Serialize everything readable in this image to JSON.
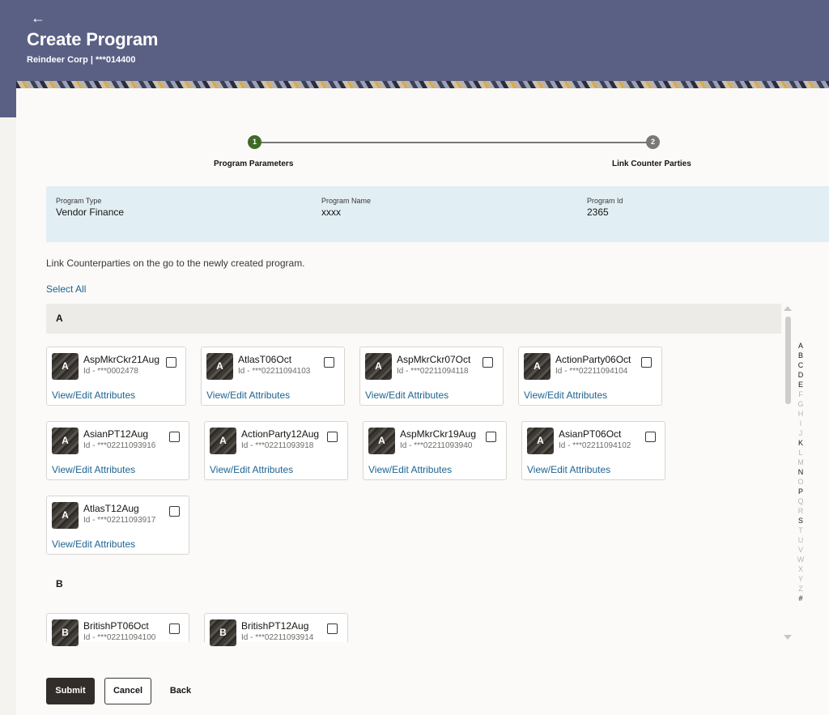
{
  "header": {
    "back_icon": "←",
    "title": "Create Program",
    "subtitle": "Reindeer Corp | ***014400"
  },
  "stepper": {
    "steps": [
      {
        "number": "1",
        "label": "Program Parameters",
        "status": "complete",
        "color": "#3f6a27"
      },
      {
        "number": "2",
        "label": "Link Counter Parties",
        "status": "current",
        "color": "#7a7875"
      }
    ]
  },
  "program": {
    "type_label": "Program Type",
    "type_value": "Vendor Finance",
    "name_label": "Program Name",
    "name_value": "xxxx",
    "id_label": "Program Id",
    "id_value": "2365"
  },
  "intro_text": "Link Counterparties on the go to the newly created program.",
  "select_all": "Select All",
  "link_label": "View/Edit Attributes",
  "groups": [
    {
      "letter": "A",
      "counterparties": [
        {
          "initial": "A",
          "name": "AspMkrCkr21Aug",
          "id": "Id - ***0002478"
        },
        {
          "initial": "A",
          "name": "AtlasT06Oct",
          "id": "Id - ***02211094103"
        },
        {
          "initial": "A",
          "name": "AspMkrCkr07Oct",
          "id": "Id - ***02211094118"
        },
        {
          "initial": "A",
          "name": "ActionParty06Oct",
          "id": "Id - ***02211094104"
        },
        {
          "initial": "A",
          "name": "AsianPT12Aug",
          "id": "Id - ***02211093916"
        },
        {
          "initial": "A",
          "name": "ActionParty12Aug",
          "id": "Id - ***02211093918"
        },
        {
          "initial": "A",
          "name": "AspMkrCkr19Aug",
          "id": "Id - ***02211093940"
        },
        {
          "initial": "A",
          "name": "AsianPT06Oct",
          "id": "Id - ***02211094102"
        },
        {
          "initial": "A",
          "name": "AtlasT12Aug",
          "id": "Id - ***02211093917"
        }
      ]
    },
    {
      "letter": "B",
      "counterparties": [
        {
          "initial": "B",
          "name": "BritishPT06Oct",
          "id": "Id - ***02211094100"
        },
        {
          "initial": "B",
          "name": "BritishPT12Aug",
          "id": "Id - ***02211093914"
        }
      ]
    }
  ],
  "alphabet_index": [
    {
      "letter": "A",
      "active": true
    },
    {
      "letter": "B",
      "active": true
    },
    {
      "letter": "C",
      "active": true
    },
    {
      "letter": "D",
      "active": true
    },
    {
      "letter": "E",
      "active": true
    },
    {
      "letter": "F",
      "active": false
    },
    {
      "letter": "G",
      "active": false
    },
    {
      "letter": "H",
      "active": false
    },
    {
      "letter": "I",
      "active": false
    },
    {
      "letter": "J",
      "active": false
    },
    {
      "letter": "K",
      "active": true
    },
    {
      "letter": "L",
      "active": false
    },
    {
      "letter": "M",
      "active": false
    },
    {
      "letter": "N",
      "active": true
    },
    {
      "letter": "O",
      "active": false
    },
    {
      "letter": "P",
      "active": true
    },
    {
      "letter": "Q",
      "active": false
    },
    {
      "letter": "R",
      "active": false
    },
    {
      "letter": "S",
      "active": true
    },
    {
      "letter": "T",
      "active": false
    },
    {
      "letter": "U",
      "active": false
    },
    {
      "letter": "V",
      "active": false
    },
    {
      "letter": "W",
      "active": false
    },
    {
      "letter": "X",
      "active": false
    },
    {
      "letter": "Y",
      "active": false
    },
    {
      "letter": "Z",
      "active": false
    },
    {
      "letter": "#",
      "active": true
    }
  ],
  "buttons": {
    "submit": "Submit",
    "cancel": "Cancel",
    "back": "Back"
  },
  "colors": {
    "header_bg": "#5a5f84",
    "link": "#1d6390",
    "info_band": "#e1eef3",
    "primary_button": "#312d2a"
  }
}
